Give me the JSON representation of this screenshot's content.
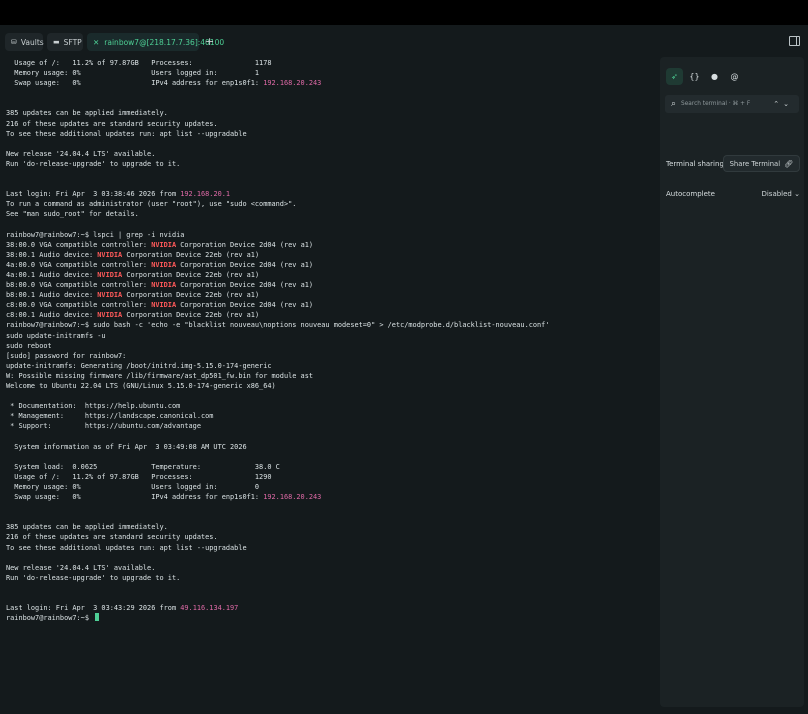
{
  "tabs": {
    "vaults": "Vaults",
    "sftp": "SFTP",
    "active": "rainbow7@[218.17.7.36]:40100",
    "new_tab": "+"
  },
  "terminal": {
    "lines": [
      [
        {
          "t": "  Usage of /:   11.2% of 97.87GB   Processes:               1178"
        }
      ],
      [
        {
          "t": "  Memory usage: 0%                 Users logged in:         1"
        }
      ],
      [
        {
          "t": "  Swap usage:   0%                 IPv4 address for enp1s0f1: "
        },
        {
          "t": "192.168.20.243",
          "c": "ip"
        }
      ],
      [],
      [],
      [
        {
          "t": "385 updates can be applied immediately."
        }
      ],
      [
        {
          "t": "216 of these updates are standard security updates."
        }
      ],
      [
        {
          "t": "To see these additional updates run: apt list --upgradable"
        }
      ],
      [],
      [
        {
          "t": "New release '24.04.4 LTS' available."
        }
      ],
      [
        {
          "t": "Run 'do-release-upgrade' to upgrade to it."
        }
      ],
      [],
      [],
      [
        {
          "t": "Last login: Fri Apr  3 03:38:46 2026 from "
        },
        {
          "t": "192.168.20.1",
          "c": "ip"
        }
      ],
      [
        {
          "t": "To run a command as administrator (user \"root\"), use \"sudo <command>\"."
        }
      ],
      [
        {
          "t": "See \"man sudo_root\" for details."
        }
      ],
      [],
      [
        {
          "t": "rainbow7@rainbow7:~$ lspci | grep -i nvidia"
        }
      ],
      [
        {
          "t": "38:00.0 VGA compatible controller: "
        },
        {
          "t": "NVIDIA",
          "c": "nv"
        },
        {
          "t": " Corporation Device 2d04 (rev a1)"
        }
      ],
      [
        {
          "t": "38:00.1 Audio device: "
        },
        {
          "t": "NVIDIA",
          "c": "nv"
        },
        {
          "t": " Corporation Device 22eb (rev a1)"
        }
      ],
      [
        {
          "t": "4a:00.0 VGA compatible controller: "
        },
        {
          "t": "NVIDIA",
          "c": "nv"
        },
        {
          "t": " Corporation Device 2d04 (rev a1)"
        }
      ],
      [
        {
          "t": "4a:00.1 Audio device: "
        },
        {
          "t": "NVIDIA",
          "c": "nv"
        },
        {
          "t": " Corporation Device 22eb (rev a1)"
        }
      ],
      [
        {
          "t": "b8:00.0 VGA compatible controller: "
        },
        {
          "t": "NVIDIA",
          "c": "nv"
        },
        {
          "t": " Corporation Device 2d04 (rev a1)"
        }
      ],
      [
        {
          "t": "b8:00.1 Audio device: "
        },
        {
          "t": "NVIDIA",
          "c": "nv"
        },
        {
          "t": " Corporation Device 22eb (rev a1)"
        }
      ],
      [
        {
          "t": "c8:00.0 VGA compatible controller: "
        },
        {
          "t": "NVIDIA",
          "c": "nv"
        },
        {
          "t": " Corporation Device 2d04 (rev a1)"
        }
      ],
      [
        {
          "t": "c8:00.1 Audio device: "
        },
        {
          "t": "NVIDIA",
          "c": "nv"
        },
        {
          "t": " Corporation Device 22eb (rev a1)"
        }
      ],
      [
        {
          "t": "rainbow7@rainbow7:~$ sudo bash -c 'echo -e \"blacklist nouveau\\noptions nouveau modeset=0\" > /etc/modprobe.d/blacklist-nouveau.conf'"
        }
      ],
      [
        {
          "t": "sudo update-initramfs -u"
        }
      ],
      [
        {
          "t": "sudo reboot"
        }
      ],
      [
        {
          "t": "[sudo] password for rainbow7:"
        }
      ],
      [
        {
          "t": "update-initramfs: Generating /boot/initrd.img-5.15.0-174-generic"
        }
      ],
      [
        {
          "t": "W: Possible missing firmware /lib/firmware/ast_dp501_fw.bin for module ast"
        }
      ],
      [
        {
          "t": "Welcome to Ubuntu 22.04 LTS (GNU/Linux 5.15.0-174-generic x86_64)"
        }
      ],
      [],
      [
        {
          "t": " * Documentation:  https://help.ubuntu.com"
        }
      ],
      [
        {
          "t": " * Management:     https://landscape.canonical.com"
        }
      ],
      [
        {
          "t": " * Support:        https://ubuntu.com/advantage"
        }
      ],
      [],
      [
        {
          "t": "  System information as of Fri Apr  3 03:49:08 AM UTC 2026"
        }
      ],
      [],
      [
        {
          "t": "  System load:  0.0625             Temperature:             38.0 C"
        }
      ],
      [
        {
          "t": "  Usage of /:   11.2% of 97.87GB   Processes:               1290"
        }
      ],
      [
        {
          "t": "  Memory usage: 0%                 Users logged in:         0"
        }
      ],
      [
        {
          "t": "  Swap usage:   0%                 IPv4 address for enp1s0f1: "
        },
        {
          "t": "192.168.20.243",
          "c": "ip"
        }
      ],
      [],
      [],
      [
        {
          "t": "385 updates can be applied immediately."
        }
      ],
      [
        {
          "t": "216 of these updates are standard security updates."
        }
      ],
      [
        {
          "t": "To see these additional updates run: apt list --upgradable"
        }
      ],
      [],
      [
        {
          "t": "New release '24.04.4 LTS' available."
        }
      ],
      [
        {
          "t": "Run 'do-release-upgrade' to upgrade to it."
        }
      ],
      [],
      [],
      [
        {
          "t": "Last login: Fri Apr  3 03:43:29 2026 from "
        },
        {
          "t": "49.116.134.197",
          "c": "ip"
        }
      ],
      [
        {
          "t": "rainbow7@rainbow7:~$ "
        }
      ]
    ]
  },
  "sidebar": {
    "search_placeholder": "Search terminal · ⌘ + F",
    "terminal_sharing_label": "Terminal sharing",
    "share_button": "Share Terminal",
    "autocomplete_label": "Autocomplete",
    "autocomplete_value": "Disabled"
  },
  "colors": {
    "accent": "#4ecf95",
    "ip_highlight": "#e06aa7",
    "nvidia_highlight": "#ff5a5a",
    "background": "#141a1c"
  }
}
